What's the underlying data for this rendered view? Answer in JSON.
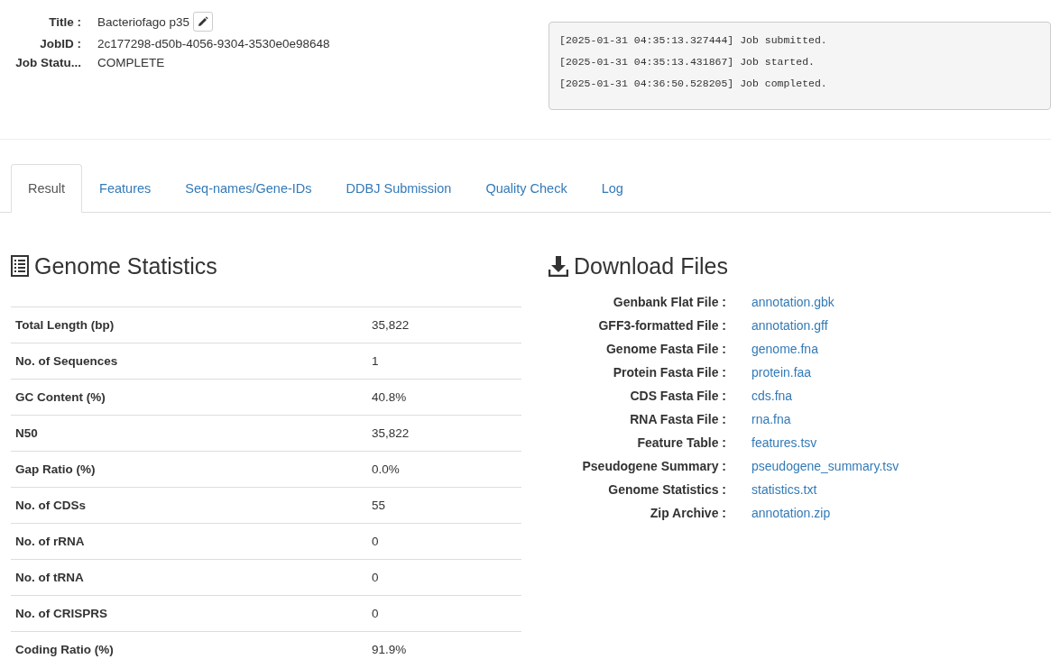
{
  "job": {
    "fields": [
      {
        "label": "Title :",
        "value": "Bacteriofago p35",
        "editable": true
      },
      {
        "label": "JobID :",
        "value": "2c177298-d50b-4056-9304-3530e0e98648",
        "editable": false
      },
      {
        "label": "Job Statu...",
        "value": "COMPLETE",
        "editable": false
      }
    ],
    "log": [
      "[2025-01-31 04:35:13.327444] Job submitted.",
      "[2025-01-31 04:35:13.431867] Job started.",
      "[2025-01-31 04:36:50.528205] Job completed."
    ]
  },
  "tabs": [
    {
      "label": "Result",
      "selected": true
    },
    {
      "label": "Features",
      "selected": false
    },
    {
      "label": "Seq-names/Gene-IDs",
      "selected": false
    },
    {
      "label": "DDBJ Submission",
      "selected": false
    },
    {
      "label": "Quality Check",
      "selected": false
    },
    {
      "label": "Log",
      "selected": false
    }
  ],
  "genome_statistics": {
    "title": "Genome Statistics",
    "rows": [
      {
        "label": "Total Length (bp)",
        "value": "35,822"
      },
      {
        "label": "No. of Sequences",
        "value": "1"
      },
      {
        "label": "GC Content (%)",
        "value": "40.8%"
      },
      {
        "label": "N50",
        "value": "35,822"
      },
      {
        "label": "Gap Ratio (%)",
        "value": "0.0%"
      },
      {
        "label": "No. of CDSs",
        "value": "55"
      },
      {
        "label": "No. of rRNA",
        "value": "0"
      },
      {
        "label": "No. of tRNA",
        "value": "0"
      },
      {
        "label": "No. of CRISPRS",
        "value": "0"
      },
      {
        "label": "Coding Ratio (%)",
        "value": "91.9%"
      }
    ]
  },
  "download_files": {
    "title": "Download Files",
    "files": [
      {
        "label": "Genbank Flat File :",
        "link": "annotation.gbk"
      },
      {
        "label": "GFF3-formatted File :",
        "link": "annotation.gff"
      },
      {
        "label": "Genome Fasta File :",
        "link": "genome.fna"
      },
      {
        "label": "Protein Fasta File :",
        "link": "protein.faa"
      },
      {
        "label": "CDS Fasta File :",
        "link": "cds.fna"
      },
      {
        "label": "RNA Fasta File :",
        "link": "rna.fna"
      },
      {
        "label": "Feature Table :",
        "link": "features.tsv"
      },
      {
        "label": "Pseudogene Summary :",
        "link": "pseudogene_summary.tsv"
      },
      {
        "label": "Genome Statistics :",
        "link": "statistics.txt"
      },
      {
        "label": "Zip Archive :",
        "link": "annotation.zip"
      }
    ]
  }
}
